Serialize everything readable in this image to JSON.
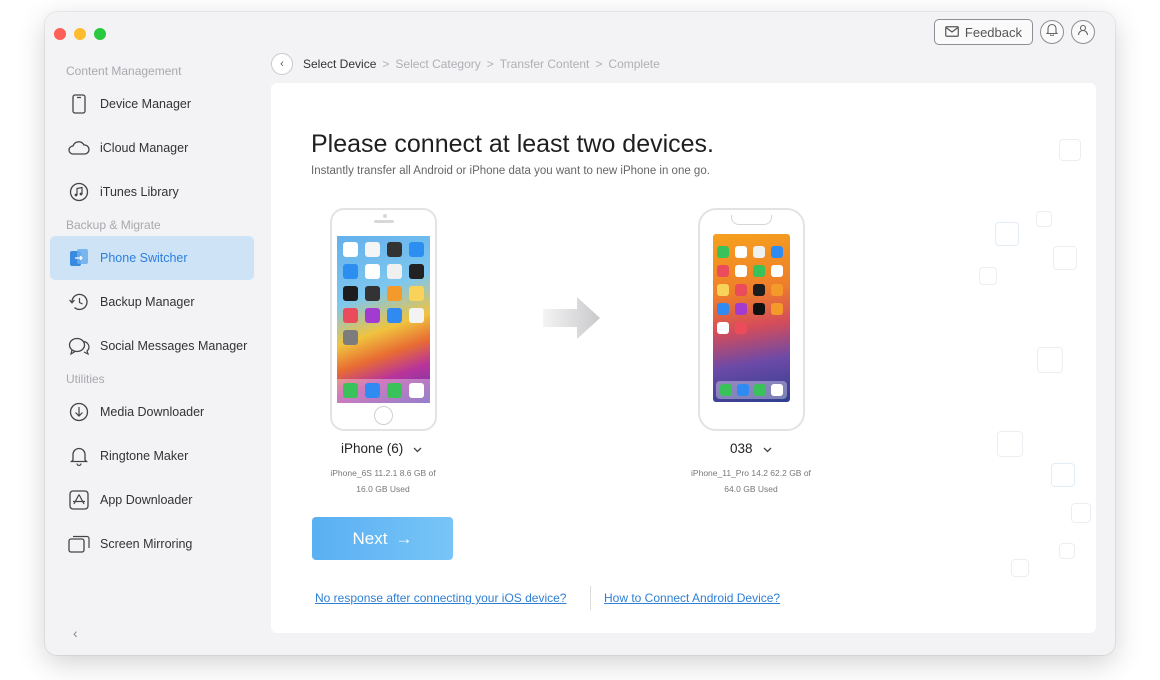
{
  "window": {
    "feedback_label": "Feedback"
  },
  "sidebar": {
    "sections": [
      {
        "title": "Content Management",
        "items": [
          {
            "label": "Device Manager",
            "icon": "phone-icon"
          },
          {
            "label": "iCloud Manager",
            "icon": "cloud-icon"
          },
          {
            "label": "iTunes Library",
            "icon": "music-disc-icon"
          }
        ]
      },
      {
        "title": "Backup & Migrate",
        "items": [
          {
            "label": "Phone Switcher",
            "icon": "phone-switch-icon",
            "active": true
          },
          {
            "label": "Backup Manager",
            "icon": "clock-back-icon"
          },
          {
            "label": "Social Messages Manager",
            "icon": "chat-bubbles-icon"
          }
        ]
      },
      {
        "title": "Utilities",
        "items": [
          {
            "label": "Media Downloader",
            "icon": "download-circle-icon"
          },
          {
            "label": "Ringtone Maker",
            "icon": "bell-icon"
          },
          {
            "label": "App Downloader",
            "icon": "app-store-icon"
          },
          {
            "label": "Screen Mirroring",
            "icon": "mirror-screens-icon"
          }
        ]
      }
    ],
    "collapse_glyph": "‹"
  },
  "breadcrumb": {
    "back_glyph": "‹",
    "steps": [
      "Select Device",
      "Select Category",
      "Transfer Content",
      "Complete"
    ],
    "separator": ">",
    "current_index": 0
  },
  "main": {
    "title": "Please connect at least two devices.",
    "subtitle": "Instantly transfer all Android or iPhone data you want to new iPhone in one go.",
    "source_device": {
      "name": "iPhone (6)",
      "info_line1": "iPhone_6S 11.2.1 8.6 GB of",
      "info_line2": "16.0 GB Used"
    },
    "target_device": {
      "name": "038",
      "info_line1": "iPhone_11_Pro 14.2 62.2 GB of",
      "info_line2": "64.0 GB Used"
    },
    "next_label": "Next",
    "next_arrow": "→",
    "link_ios": "No response after connecting your iOS device?",
    "link_android": "How to Connect Android Device?"
  },
  "colors": {
    "accent": "#2a7fe0",
    "active_bg": "#cfe3f7",
    "next_button": "#5fb4f3",
    "link": "#2e7fd6"
  }
}
